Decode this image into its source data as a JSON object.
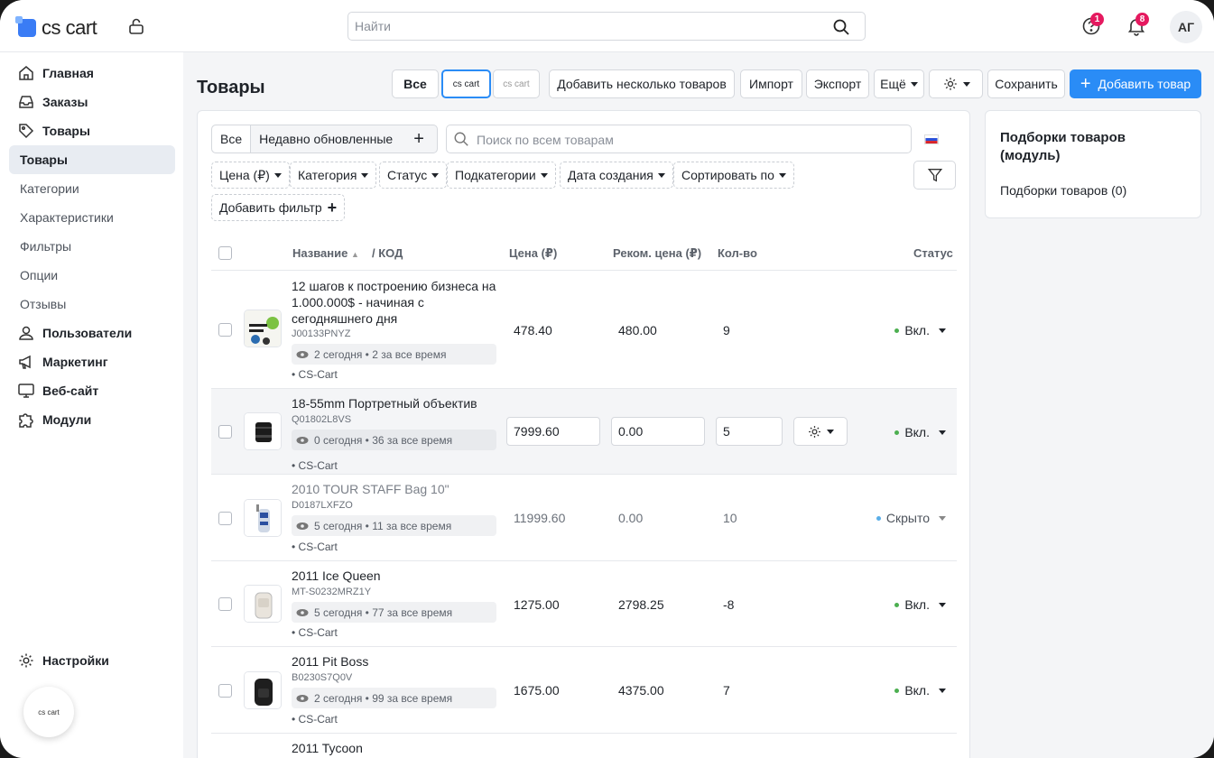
{
  "topbar": {
    "logo_text": "cs cart",
    "search_placeholder": "Найти",
    "help_badge": "1",
    "notifications_badge": "8",
    "avatar_initials": "АГ"
  },
  "sidebar": {
    "items": [
      {
        "label": "Главная",
        "icon": "home-icon"
      },
      {
        "label": "Заказы",
        "icon": "inbox-icon"
      },
      {
        "label": "Товары",
        "icon": "tag-icon"
      },
      {
        "label": "Товары",
        "icon": ""
      },
      {
        "label": "Категории",
        "icon": ""
      },
      {
        "label": "Характеристики",
        "icon": ""
      },
      {
        "label": "Фильтры",
        "icon": ""
      },
      {
        "label": "Опции",
        "icon": ""
      },
      {
        "label": "Отзывы",
        "icon": ""
      },
      {
        "label": "Пользователи",
        "icon": "user-icon"
      },
      {
        "label": "Маркетинг",
        "icon": "megaphone-icon"
      },
      {
        "label": "Веб-сайт",
        "icon": "monitor-icon"
      },
      {
        "label": "Модули",
        "icon": "puzzle-icon"
      }
    ],
    "settings_label": "Настройки",
    "bubble_logo": "cs cart"
  },
  "toolbar": {
    "page_title": "Товары",
    "all_label": "Все",
    "store1": "cs cart",
    "store2": "cs cart",
    "add_multiple": "Добавить несколько товаров",
    "import": "Импорт",
    "export": "Экспорт",
    "more": "Ещё",
    "save": "Сохранить",
    "add_product": "Добавить товар"
  },
  "filters": {
    "tab_all": "Все",
    "tab_recent": "Недавно обновленные",
    "search_placeholder": "Поиск по всем товарам",
    "chips": [
      "Цена (₽)",
      "Категория",
      "Статус",
      "Подкатегории",
      "Дата создания",
      "Сортировать по"
    ],
    "add_filter": "Добавить фильтр"
  },
  "table": {
    "headers": {
      "name": "Название",
      "code": "/ КОД",
      "price": "Цена (₽)",
      "list_price": "Реком. цена (₽)",
      "qty": "Кол-во",
      "status": "Статус"
    },
    "rows": [
      {
        "name": "12 шагов к построению бизнеса на 1.000.000$ - начиная с сегодняшнего дня",
        "code": "J00133PNYZ",
        "views": "2 сегодня • 2 за все время",
        "vendor": "• CS-Cart",
        "price": "478.40",
        "list_price": "480.00",
        "qty": "9",
        "status": "Вкл."
      },
      {
        "name": "18-55mm Портретный объектив",
        "code": "Q01802L8VS",
        "views": "0 сегодня • 36 за все время",
        "vendor": "• CS-Cart",
        "price": "7999.60",
        "list_price": "0.00",
        "qty": "5",
        "status": "Вкл."
      },
      {
        "name": "2010 TOUR STAFF Bag 10\"",
        "code": "D0187LXFZO",
        "views": "5 сегодня • 11 за все время",
        "vendor": "• CS-Cart",
        "price": "11999.60",
        "list_price": "0.00",
        "qty": "10",
        "status": "Скрыто"
      },
      {
        "name": "2011 Ice Queen",
        "code": "MT-S0232MRZ1Y",
        "views": "5 сегодня • 77 за все время",
        "vendor": "• CS-Cart",
        "price": "1275.00",
        "list_price": "2798.25",
        "qty": "-8",
        "status": "Вкл."
      },
      {
        "name": "2011 Pit Boss",
        "code": "B0230S7Q0V",
        "views": "2 сегодня • 99 за все время",
        "vendor": "• CS-Cart",
        "price": "1675.00",
        "list_price": "4375.00",
        "qty": "7",
        "status": "Вкл."
      },
      {
        "name": "2011 Tycoon",
        "code": "",
        "views": "",
        "vendor": "",
        "price": "",
        "list_price": "",
        "qty": "",
        "status": ""
      }
    ]
  },
  "right_panel": {
    "title": "Подборки товаров (модуль)",
    "link": "Подборки товаров (0)"
  },
  "colors": {
    "primary": "#2a8cf6",
    "active_dot": "#4caf50",
    "hidden_dot": "#5aaee8",
    "badge": "#e5195f"
  }
}
